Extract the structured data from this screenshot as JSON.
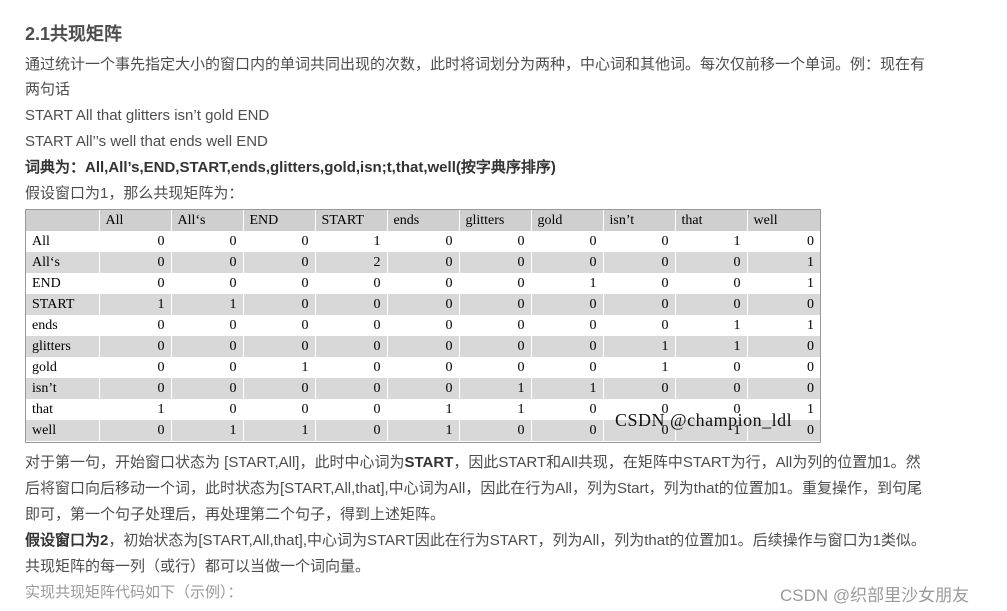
{
  "heading": "2.1共现矩阵",
  "intro_line1": "通过统计一个事先指定大小的窗口内的单词共同出现的次数，此时将词划分为两种，中心词和其他词。每次仅前移一个单词。例：现在有",
  "intro_line2": "两句话",
  "sentence1": "START All that glitters isn’t gold END",
  "sentence2": "START All’’s well that ends well END",
  "dictionary": "词典为：All,All’s,END,START,ends,glitters,gold,isn;t,that,well(按字典序排序)",
  "window_intro": "假设窗口为1，那么共现矩阵为：",
  "matrix": {
    "columns": [
      "All",
      "All‘s",
      "END",
      "START",
      "ends",
      "glitters",
      "gold",
      "isn’t",
      "that",
      "well"
    ],
    "rows": [
      {
        "label": "All",
        "values": [
          "0",
          "0",
          "0",
          "1",
          "0",
          "0",
          "0",
          "0",
          "1",
          "0"
        ]
      },
      {
        "label": "All‘s",
        "values": [
          "0",
          "0",
          "0",
          "2",
          "0",
          "0",
          "0",
          "0",
          "0",
          "1"
        ]
      },
      {
        "label": "END",
        "values": [
          "0",
          "0",
          "0",
          "0",
          "0",
          "0",
          "1",
          "0",
          "0",
          "1"
        ]
      },
      {
        "label": "START",
        "values": [
          "1",
          "1",
          "0",
          "0",
          "0",
          "0",
          "0",
          "0",
          "0",
          "0"
        ]
      },
      {
        "label": "ends",
        "values": [
          "0",
          "0",
          "0",
          "0",
          "0",
          "0",
          "0",
          "0",
          "1",
          "1"
        ]
      },
      {
        "label": "glitters",
        "values": [
          "0",
          "0",
          "0",
          "0",
          "0",
          "0",
          "0",
          "1",
          "1",
          "0"
        ]
      },
      {
        "label": "gold",
        "values": [
          "0",
          "0",
          "1",
          "0",
          "0",
          "0",
          "0",
          "1",
          "0",
          "0"
        ]
      },
      {
        "label": "isn’t",
        "values": [
          "0",
          "0",
          "0",
          "0",
          "0",
          "1",
          "1",
          "0",
          "0",
          "0"
        ]
      },
      {
        "label": "that",
        "values": [
          "1",
          "0",
          "0",
          "0",
          "1",
          "1",
          "0",
          "0",
          "0",
          "1"
        ]
      },
      {
        "label": "well",
        "values": [
          "0",
          "1",
          "1",
          "0",
          "1",
          "0",
          "0",
          "0",
          "1",
          "0"
        ]
      }
    ]
  },
  "watermark_image": "CSDN @champion_ldl",
  "para1_line1_pre": "对于第一句，开始窗口状态为 [START,All]，此时中心词为",
  "para1_line1_bold": "START",
  "para1_line1_post": "，因此START和All共现，在矩阵中START为行，All为列的位置加1。然",
  "para1_line2": "后将窗口向后移动一个词，此时状态为[START,All,that],中心词为All，因此在行为All，列为Start，列为that的位置加1。重复操作，到句尾",
  "para1_line3": "即可，第一个句子处理后，再处理第二个句子，得到上述矩阵。",
  "para2_bold": "假设窗口为2",
  "para2_line1_post": "，初始状态为[START,All,that],中心词为START因此在行为START，列为All，列为that的位置加1。后续操作与窗口为1类似。",
  "para2_line2": "共现矩阵的每一列（或行）都可以当做一个词向量。",
  "code_intro": "实现共现矩阵代码如下（示例）：",
  "watermark_page": "CSDN @织部里沙女朋友"
}
